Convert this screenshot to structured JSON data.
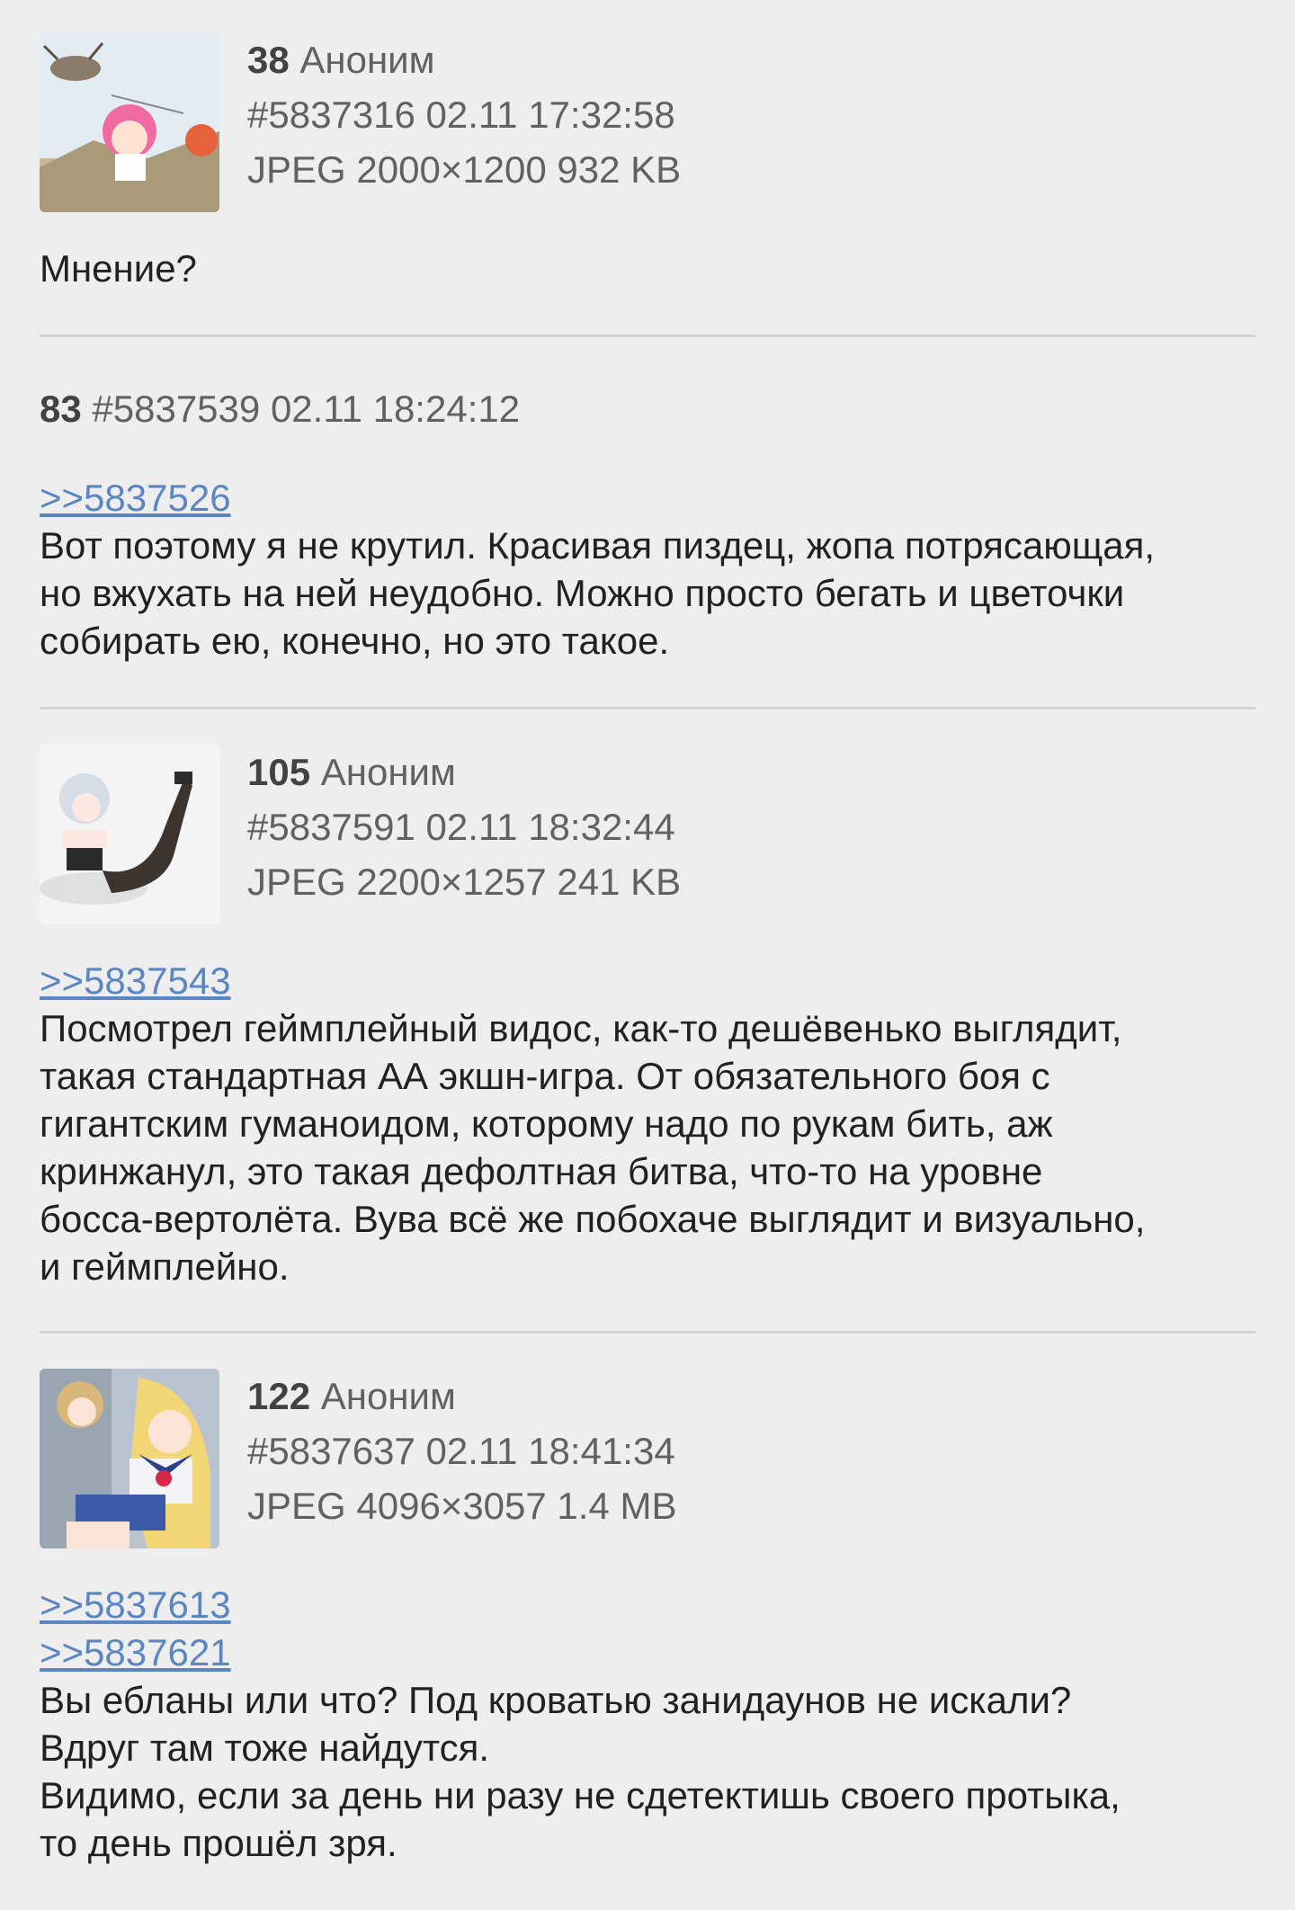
{
  "posts": [
    {
      "index": "38",
      "author": "Аноним",
      "id": "#5837316",
      "datetime": "02.11 17:32:58",
      "file": "JPEG 2000×1200 932 KB",
      "replies": [],
      "text": [
        "Мнение?"
      ]
    },
    {
      "index": "83",
      "author": "",
      "id": "#5837539",
      "datetime": "02.11 18:24:12",
      "file": "",
      "replies": [
        ">>5837526"
      ],
      "text": [
        "Вот поэтому я не крутил. Красивая пиздец, жопа потрясающая,",
        "но вжухать на ней неудобно. Можно просто бегать и цветочки",
        "собирать ею, конечно, но это такое."
      ]
    },
    {
      "index": "105",
      "author": "Аноним",
      "id": "#5837591",
      "datetime": "02.11 18:32:44",
      "file": "JPEG 2200×1257 241 KB",
      "replies": [
        ">>5837543"
      ],
      "text": [
        "Посмотрел геймплейный видос, как-то дешёвенько выглядит,",
        "такая стандартная АА экшн-игра. От обязательного боя с",
        "гигантским гуманоидом, которому надо по рукам бить, аж",
        "кринжанул, это такая дефолтная битва, что-то на уровне",
        "босса-вертолёта. Вува всё же побохаче выглядит и визуально,",
        "и геймплейно."
      ]
    },
    {
      "index": "122",
      "author": "Аноним",
      "id": "#5837637",
      "datetime": "02.11 18:41:34",
      "file": "JPEG 4096×3057 1.4 MB",
      "replies": [
        ">>5837613",
        ">>5837621"
      ],
      "text": [
        "Вы ебланы или что? Под кроватью занидаунов не искали?",
        "Вдруг там тоже найдутся.",
        "Видимо, если за день ни разу не сдетектишь своего протыка,",
        "то день прошёл зря."
      ]
    }
  ],
  "colors": {
    "background": "#eeeeee",
    "link": "#5b86c2",
    "meta": "#616161",
    "divider": "#d4d4d4"
  }
}
